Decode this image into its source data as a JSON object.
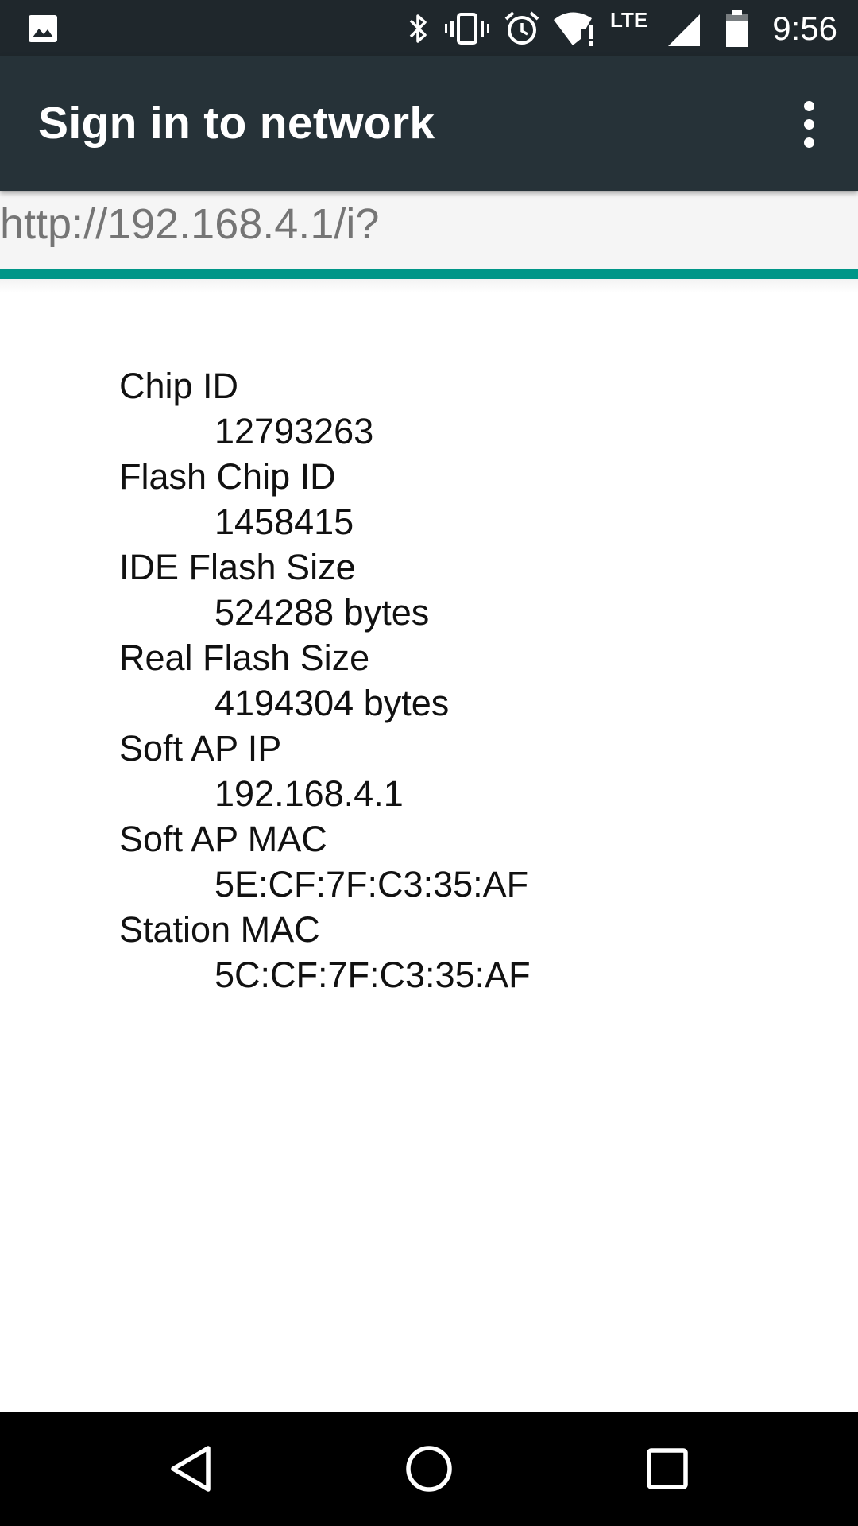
{
  "status_bar": {
    "time": "9:56",
    "network_type": "LTE",
    "icons": [
      "image-notification-icon",
      "bluetooth-icon",
      "vibrate-icon",
      "alarm-icon",
      "wifi-no-internet-icon",
      "cellular-signal-icon",
      "battery-icon"
    ]
  },
  "app_bar": {
    "title": "Sign in to network",
    "menu_icon": "overflow-menu-icon"
  },
  "url_bar": {
    "url": "http://192.168.4.1/i?",
    "progress": 1.0,
    "progress_color": "#009688"
  },
  "info": [
    {
      "label": "Chip ID",
      "value": "12793263"
    },
    {
      "label": "Flash Chip ID",
      "value": "1458415"
    },
    {
      "label": "IDE Flash Size",
      "value": "524288 bytes"
    },
    {
      "label": "Real Flash Size",
      "value": "4194304 bytes"
    },
    {
      "label": "Soft AP IP",
      "value": "192.168.4.1"
    },
    {
      "label": "Soft AP MAC",
      "value": "5E:CF:7F:C3:35:AF"
    },
    {
      "label": "Station MAC",
      "value": "5C:CF:7F:C3:35:AF"
    }
  ],
  "nav_bar": {
    "buttons": [
      "back-icon",
      "home-icon",
      "recents-icon"
    ]
  },
  "colors": {
    "status_bar": "#1f272c",
    "app_bar": "#263238",
    "accent": "#009688"
  }
}
